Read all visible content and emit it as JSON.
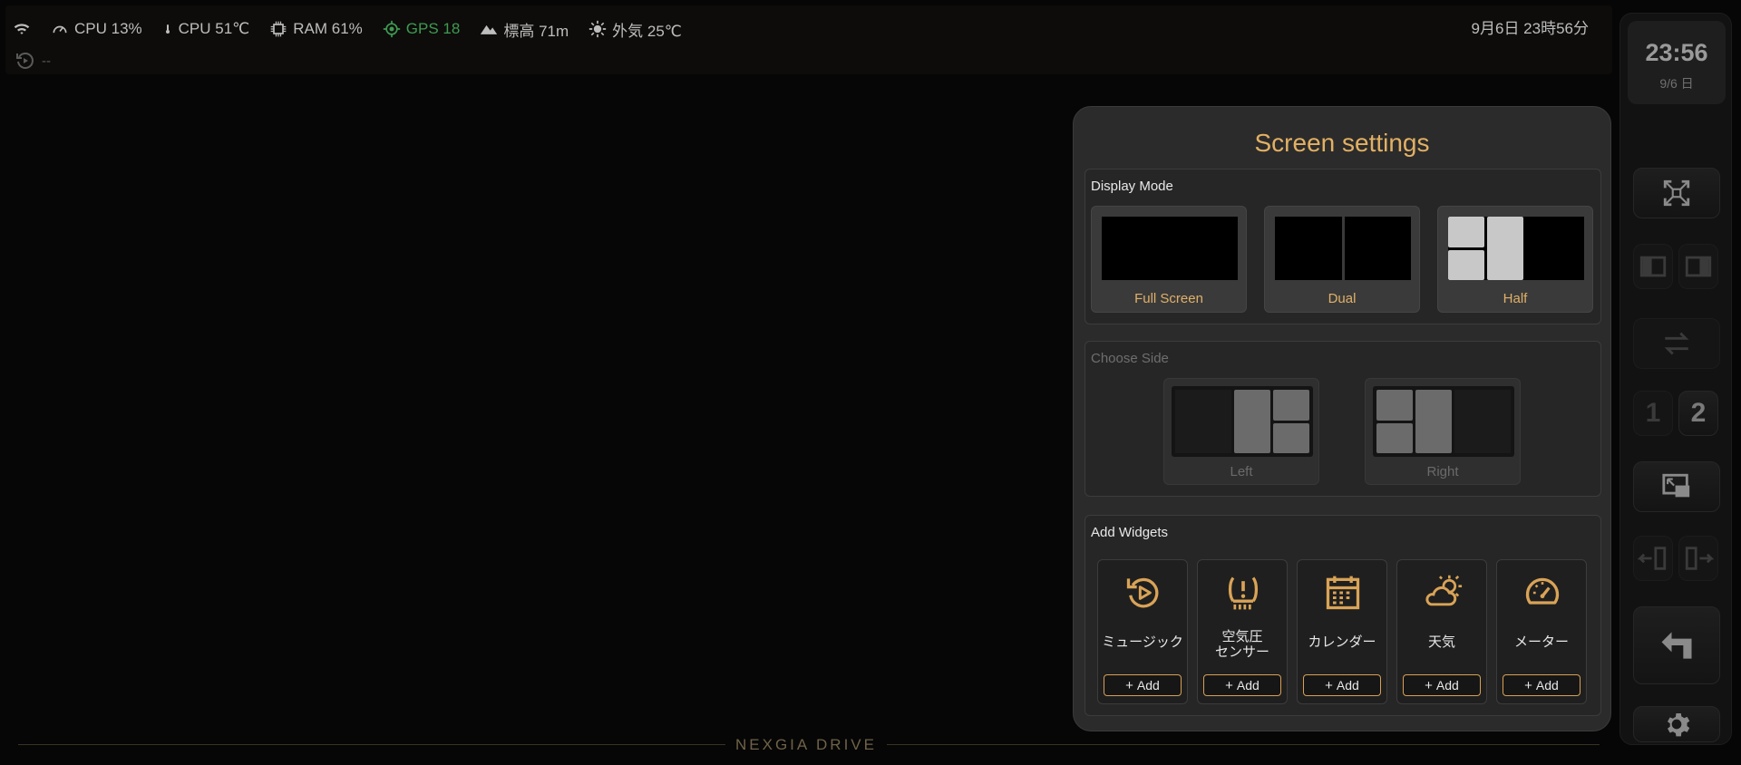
{
  "status_bar": {
    "items": [
      {
        "icon": "wifi-icon",
        "label": ""
      },
      {
        "icon": "speedometer-icon",
        "label": "CPU 13%"
      },
      {
        "icon": "thermometer-icon",
        "label": "CPU 51℃"
      },
      {
        "icon": "chip-icon",
        "label": "RAM 61%"
      },
      {
        "icon": "gps-icon",
        "label": "GPS 18"
      },
      {
        "icon": "mountain-icon",
        "label": "標高 71m"
      },
      {
        "icon": "sun-icon",
        "label": "外気 25℃"
      }
    ],
    "datetime": "9月6日 23時56分",
    "now_playing": "--"
  },
  "dock": {
    "clock_time": "23:56",
    "clock_date": "9/6 日",
    "page_numbers": [
      "1",
      "2"
    ],
    "active_page": "2"
  },
  "brand": "NEXGIA DRIVE",
  "panel": {
    "title": "Screen settings",
    "display_mode": {
      "title": "Display Mode",
      "options": [
        "Full Screen",
        "Dual",
        "Half"
      ]
    },
    "choose_side": {
      "title": "Choose Side",
      "options": [
        "Left",
        "Right"
      ]
    },
    "add_widgets": {
      "title": "Add Widgets",
      "add_label": "Add",
      "widgets": [
        {
          "name": "ミュージック",
          "icon": "music-replay-icon"
        },
        {
          "name": "空気圧\nセンサー",
          "icon": "tire-pressure-icon"
        },
        {
          "name": "カレンダー",
          "icon": "calendar-icon"
        },
        {
          "name": "天気",
          "icon": "weather-icon"
        },
        {
          "name": "メーター",
          "icon": "gauge-icon"
        }
      ]
    }
  },
  "colors": {
    "accent": "#e2b064",
    "gps": "#3f9a52"
  }
}
